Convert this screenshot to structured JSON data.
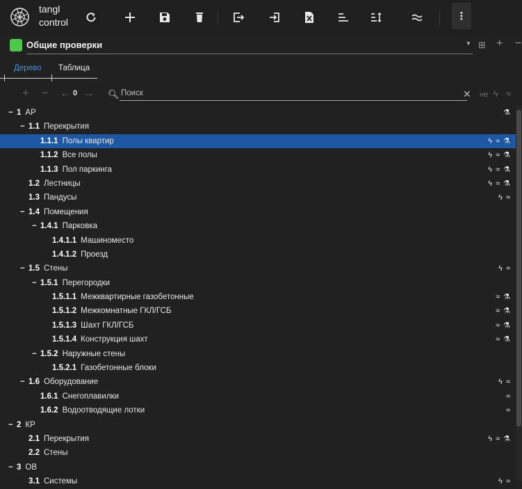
{
  "app": {
    "logo_line1": "tangl",
    "logo_line2": "control"
  },
  "toolbar": {
    "buttons": [
      {
        "name": "refresh",
        "glyph": "refresh-icon"
      },
      {
        "name": "add",
        "glyph": "plus-icon"
      },
      {
        "name": "save",
        "glyph": "save-icon"
      },
      {
        "name": "delete",
        "glyph": "trash-icon"
      },
      {
        "name": "export",
        "glyph": "export-icon"
      },
      {
        "name": "import",
        "glyph": "import-icon"
      },
      {
        "name": "excel",
        "glyph": "excel-icon"
      },
      {
        "name": "align",
        "glyph": "align-icon"
      },
      {
        "name": "sort",
        "glyph": "sort-icon"
      },
      {
        "name": "approx",
        "glyph": "approx-icon"
      }
    ],
    "more": "⋮"
  },
  "check_set": {
    "name": "Общие проверки",
    "color": "#4cc94a"
  },
  "tabs": {
    "tree": "Дерево",
    "table": "Таблица"
  },
  "tree_toolbar": {
    "counter": "0",
    "search_placeholder": "Поиск",
    "filter_ne": "не"
  },
  "tree": [
    {
      "depth": 0,
      "toggle": "−",
      "num": "1",
      "label": "АР",
      "flags": [
        "flask"
      ]
    },
    {
      "depth": 1,
      "toggle": "−",
      "num": "1.1",
      "label": "Перекрытия",
      "flags": []
    },
    {
      "depth": 2,
      "toggle": "",
      "num": "1.1.1",
      "label": "Полы квартир",
      "flags": [
        "bolt",
        "approx",
        "flask"
      ],
      "selected": true
    },
    {
      "depth": 2,
      "toggle": "",
      "num": "1.1.2",
      "label": "Все полы",
      "flags": [
        "bolt",
        "approx",
        "flask"
      ]
    },
    {
      "depth": 2,
      "toggle": "",
      "num": "1.1.3",
      "label": "Пол паркинга",
      "flags": [
        "bolt",
        "approx",
        "flask"
      ]
    },
    {
      "depth": 1,
      "toggle": "",
      "num": "1.2",
      "label": "Лестницы",
      "flags": [
        "bolt",
        "approx",
        "flask"
      ]
    },
    {
      "depth": 1,
      "toggle": "",
      "num": "1.3",
      "label": "Пандусы",
      "flags": [
        "bolt",
        "approx"
      ]
    },
    {
      "depth": 1,
      "toggle": "−",
      "num": "1.4",
      "label": "Помещения",
      "flags": []
    },
    {
      "depth": 2,
      "toggle": "−",
      "num": "1.4.1",
      "label": "Парковка",
      "flags": []
    },
    {
      "depth": 3,
      "toggle": "",
      "num": "1.4.1.1",
      "label": "Машиноместо",
      "flags": []
    },
    {
      "depth": 3,
      "toggle": "",
      "num": "1.4.1.2",
      "label": "Проезд",
      "flags": []
    },
    {
      "depth": 1,
      "toggle": "−",
      "num": "1.5",
      "label": "Стены",
      "flags": [
        "bolt",
        "approx"
      ]
    },
    {
      "depth": 2,
      "toggle": "−",
      "num": "1.5.1",
      "label": "Перегородки",
      "flags": []
    },
    {
      "depth": 3,
      "toggle": "",
      "num": "1.5.1.1",
      "label": "Межквартирные газобетонные",
      "flags": [
        "approx",
        "flask"
      ]
    },
    {
      "depth": 3,
      "toggle": "",
      "num": "1.5.1.2",
      "label": "Межкомнатные ГКЛ/ГСБ",
      "flags": [
        "approx",
        "flask"
      ]
    },
    {
      "depth": 3,
      "toggle": "",
      "num": "1.5.1.3",
      "label": "Шахт ГКЛ/ГСБ",
      "flags": [
        "approx",
        "flask"
      ]
    },
    {
      "depth": 3,
      "toggle": "",
      "num": "1.5.1.4",
      "label": "Конструкция шахт",
      "flags": [
        "approx",
        "flask"
      ]
    },
    {
      "depth": 2,
      "toggle": "−",
      "num": "1.5.2",
      "label": "Наружные стены",
      "flags": []
    },
    {
      "depth": 3,
      "toggle": "",
      "num": "1.5.2.1",
      "label": "Газобетонные блоки",
      "flags": []
    },
    {
      "depth": 1,
      "toggle": "−",
      "num": "1.6",
      "label": "Оборудование",
      "flags": [
        "bolt",
        "approx"
      ]
    },
    {
      "depth": 2,
      "toggle": "",
      "num": "1.6.1",
      "label": "Снегоплавилки",
      "flags": [
        "approx"
      ]
    },
    {
      "depth": 2,
      "toggle": "",
      "num": "1.6.2",
      "label": "Водоотводящие лотки",
      "flags": [
        "approx"
      ]
    },
    {
      "depth": 0,
      "toggle": "−",
      "num": "2",
      "label": "КР",
      "flags": []
    },
    {
      "depth": 1,
      "toggle": "",
      "num": "2.1",
      "label": "Перекрытия",
      "flags": [
        "bolt",
        "approx",
        "flask"
      ]
    },
    {
      "depth": 1,
      "toggle": "",
      "num": "2.2",
      "label": "Стены",
      "flags": []
    },
    {
      "depth": 0,
      "toggle": "−",
      "num": "3",
      "label": "ОВ",
      "flags": []
    },
    {
      "depth": 1,
      "toggle": "",
      "num": "3.1",
      "label": "Системы",
      "flags": [
        "bolt",
        "approx"
      ]
    }
  ],
  "colors": {
    "background": "#212121",
    "selection": "#1e58a4",
    "accent_tab": "#4a90d9"
  }
}
